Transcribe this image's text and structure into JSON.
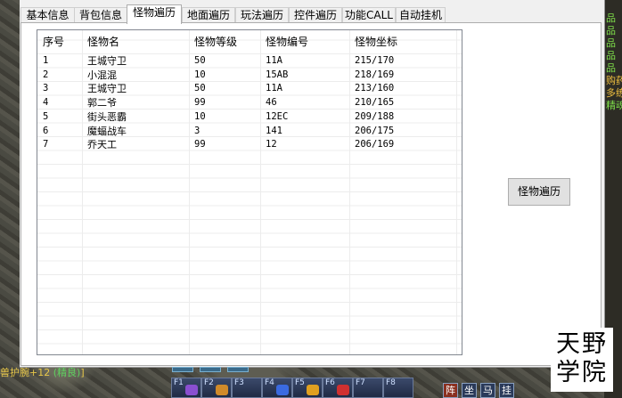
{
  "tabs": [
    "基本信息",
    "背包信息",
    "怪物遍历",
    "地面遍历",
    "玩法遍历",
    "控件遍历",
    "功能CALL",
    "自动挂机"
  ],
  "active_tab": "怪物遍历",
  "table": {
    "columns": [
      "序号",
      "怪物名",
      "怪物等级",
      "怪物编号",
      "怪物坐标"
    ],
    "rows": [
      [
        "1",
        "王城守卫",
        "50",
        "11A",
        "215/170"
      ],
      [
        "2",
        "小混混",
        "10",
        "15AB",
        "218/169"
      ],
      [
        "3",
        "王城守卫",
        "50",
        "11A",
        "213/160"
      ],
      [
        "4",
        "郭二爷",
        "99",
        "46",
        "210/165"
      ],
      [
        "5",
        "街头恶霸",
        "10",
        "12EC",
        "209/188"
      ],
      [
        "6",
        "魔蝠战车",
        "3",
        "141",
        "206/175"
      ],
      [
        "7",
        "乔天工",
        "99",
        "12",
        "206/169"
      ]
    ]
  },
  "traverse_button_label": "怪物遍历",
  "watermark": {
    "line1": "天野",
    "line2": "学院"
  },
  "game_status": {
    "prefix": "兽护腕+12 ",
    "tag": "(精良)",
    "suffix": "]"
  },
  "hotkeys": [
    "F1",
    "F2",
    "F3",
    "F4",
    "F5",
    "F6",
    "F7",
    "F8"
  ],
  "hotkey_gem_colors": [
    "#8a4fd0",
    "#d08a2a",
    "",
    "#3a6ae0",
    "#e0a020",
    "#d03030",
    "",
    ""
  ],
  "mode_buttons": [
    "阵",
    "坐",
    "马",
    "挂"
  ],
  "side_tags": [
    "品",
    "品",
    "品",
    "品",
    "品",
    "购药",
    "多练",
    "精魂"
  ]
}
